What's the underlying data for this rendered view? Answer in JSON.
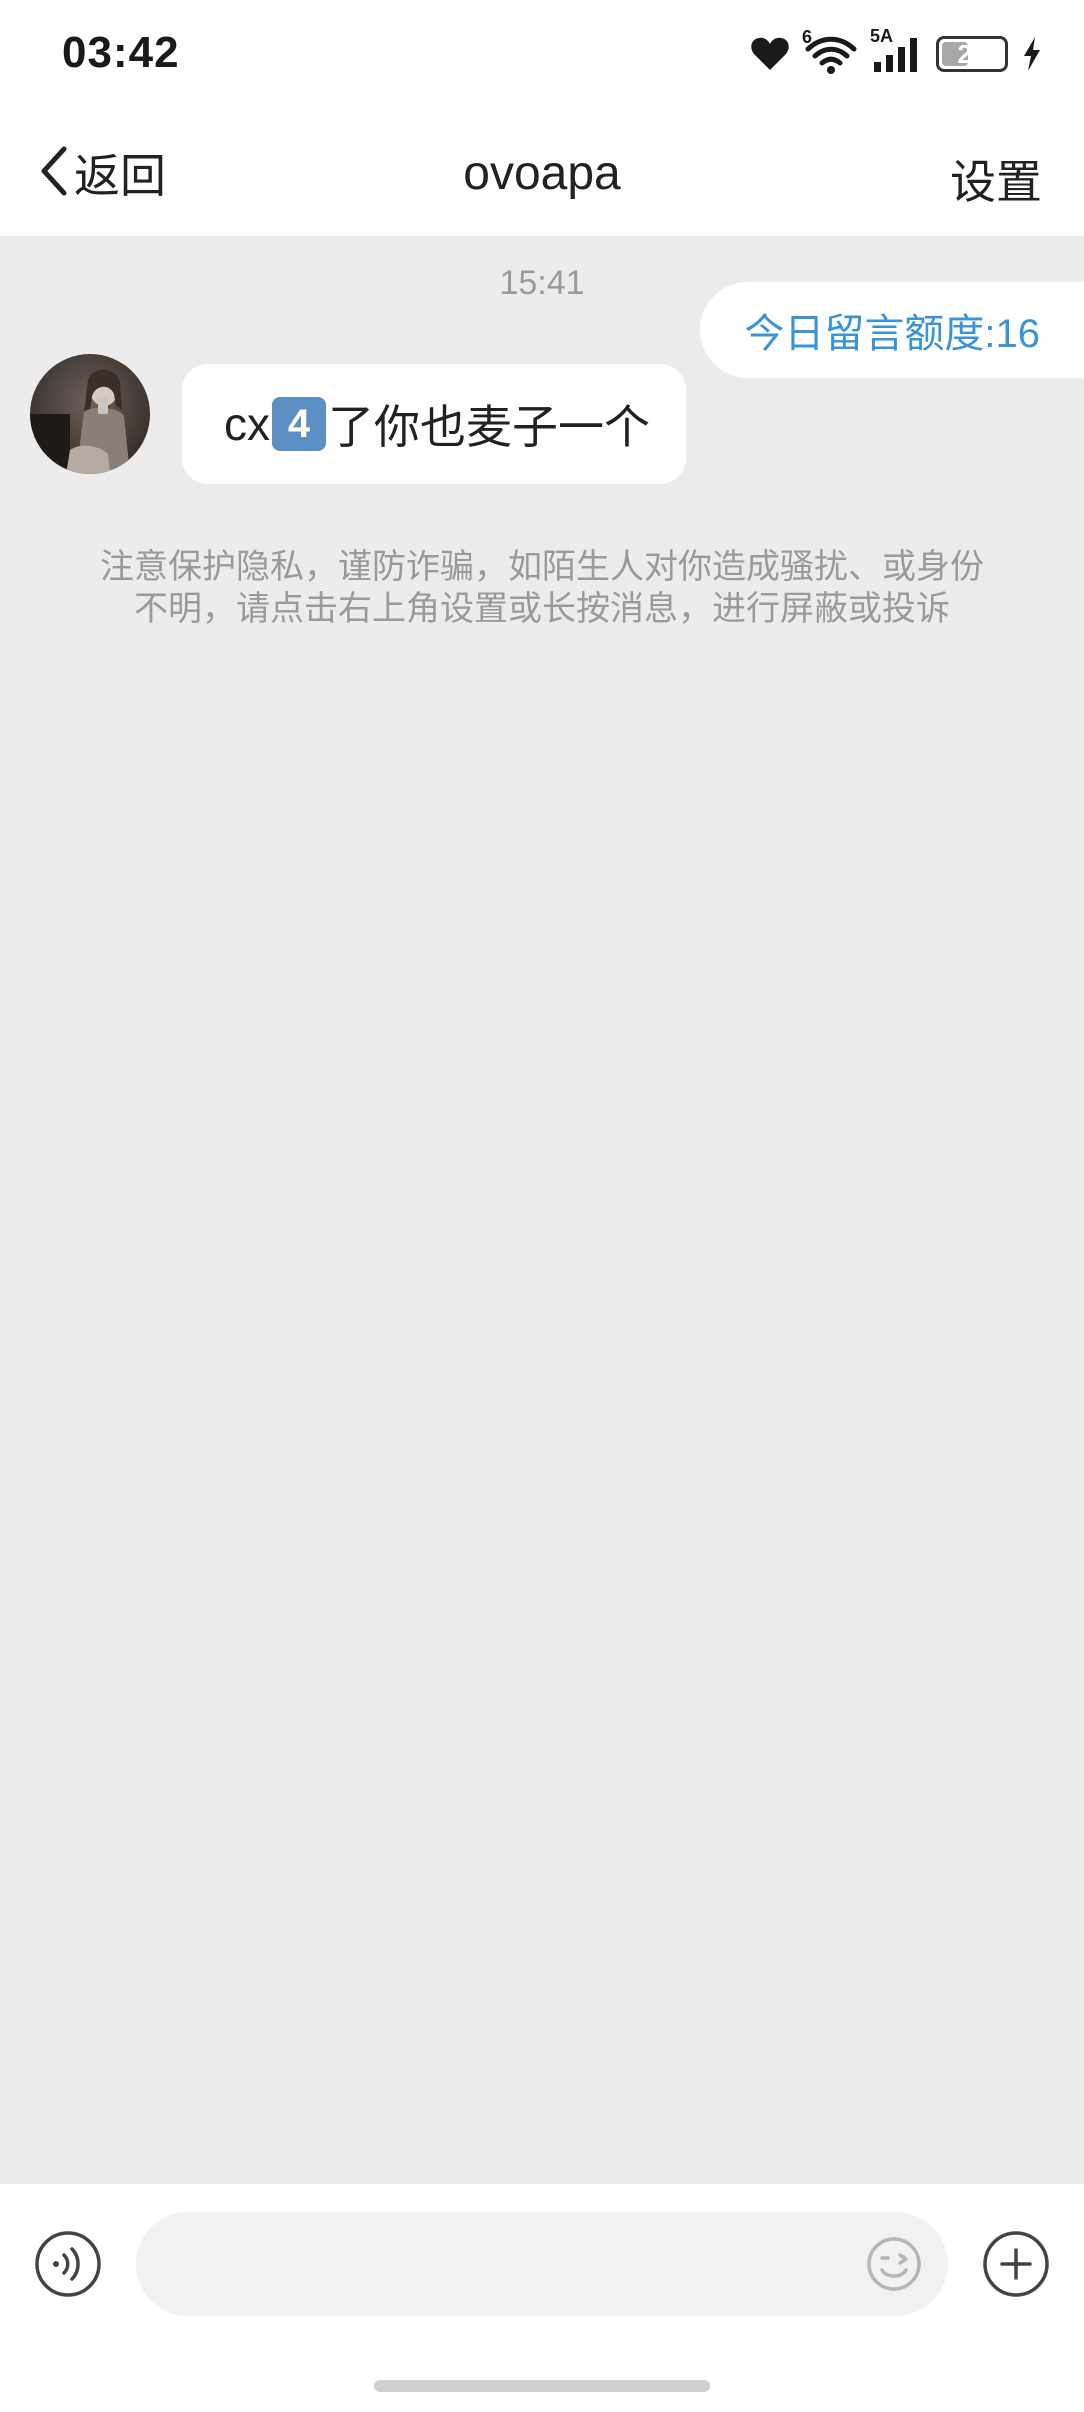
{
  "status_bar": {
    "time": "03:42",
    "network": "5A",
    "wifi_badge": "6",
    "battery_percent": 20,
    "battery_label": "20",
    "charging": true,
    "icons": [
      "heart-icon",
      "wifi-icon",
      "signal-icon",
      "battery-icon",
      "charging-bolt-icon"
    ]
  },
  "header": {
    "back_label": "返回",
    "title": "ovoapa",
    "settings_label": "设置"
  },
  "chat": {
    "timestamp": "15:41",
    "quota_label": "今日留言额度:16",
    "messages": [
      {
        "sender": "ovoapa",
        "text_before": "cx",
        "emoji": "4",
        "text_after": "了你也麦子一个"
      }
    ],
    "notice": "注意保护隐私，谨防诈骗，如陌生人对你造成骚扰、或身份不明，请点击右上角设置或长按消息，进行屏蔽或投诉"
  },
  "input_bar": {
    "placeholder": "",
    "value": "",
    "icons": [
      "voice-icon",
      "emoji-icon",
      "plus-icon"
    ]
  },
  "colors": {
    "accent": "#3b93d8",
    "background": "#ececec",
    "surface": "#ffffff",
    "muted_text": "#9a9a9a"
  }
}
